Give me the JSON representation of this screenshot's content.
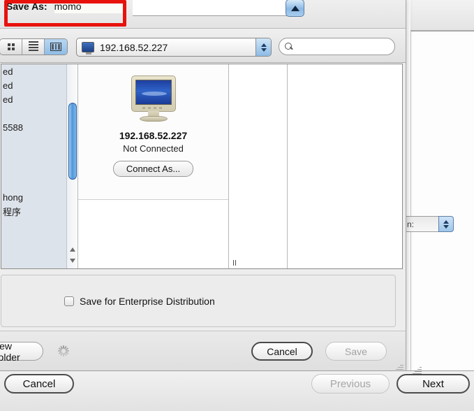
{
  "sheet": {
    "save_as_label": "Save As:",
    "file_name": "momo",
    "disclosure_icon": "triangle-up-icon"
  },
  "toolbar": {
    "views": [
      {
        "id": "icon",
        "icon": "icon-view-icon",
        "active": false
      },
      {
        "id": "list",
        "icon": "list-view-icon",
        "active": false
      },
      {
        "id": "column",
        "icon": "column-view-icon",
        "active": true
      }
    ],
    "path_popup": {
      "icon": "computer-monitor-icon",
      "label": "192.168.52.227",
      "stepper_icon": "stepper-updown-icon"
    },
    "search": {
      "icon": "search-icon",
      "placeholder": "",
      "value": ""
    }
  },
  "sidebar": {
    "items": [
      {
        "label": "ed"
      },
      {
        "label": "ed"
      },
      {
        "label": "ed"
      },
      {
        "label": ""
      },
      {
        "label": "5588"
      },
      {
        "label": ""
      },
      {
        "label": ""
      },
      {
        "label": ""
      },
      {
        "label": ""
      },
      {
        "label": "hong"
      },
      {
        "label": "程序"
      }
    ],
    "scrollbar": {
      "up_arrow": "triangle-up-icon",
      "down_arrow": "triangle-down-icon"
    }
  },
  "preview": {
    "icon": "computer-monitor-icon",
    "title": "192.168.52.227",
    "status": "Not Connected",
    "connect_button": "Connect As..."
  },
  "accessory": {
    "enterprise_checkbox_label": "Save for Enterprise Distribution",
    "enterprise_checked": false
  },
  "sheet_footer": {
    "new_folder_label": "New Folder",
    "spinner": "progress-spinner-icon",
    "cancel_label": "Cancel",
    "save_label": "Save",
    "save_disabled": true
  },
  "window_footer": {
    "cancel_label": "Cancel",
    "previous_label": "Previous",
    "previous_disabled": true,
    "next_label": "Next"
  },
  "background_window": {
    "stepper_field_text": "n:",
    "stepper_icon": "stepper-updown-icon"
  },
  "annotation": {
    "highlight_color": "#e8120d",
    "target": "save-as-field"
  }
}
